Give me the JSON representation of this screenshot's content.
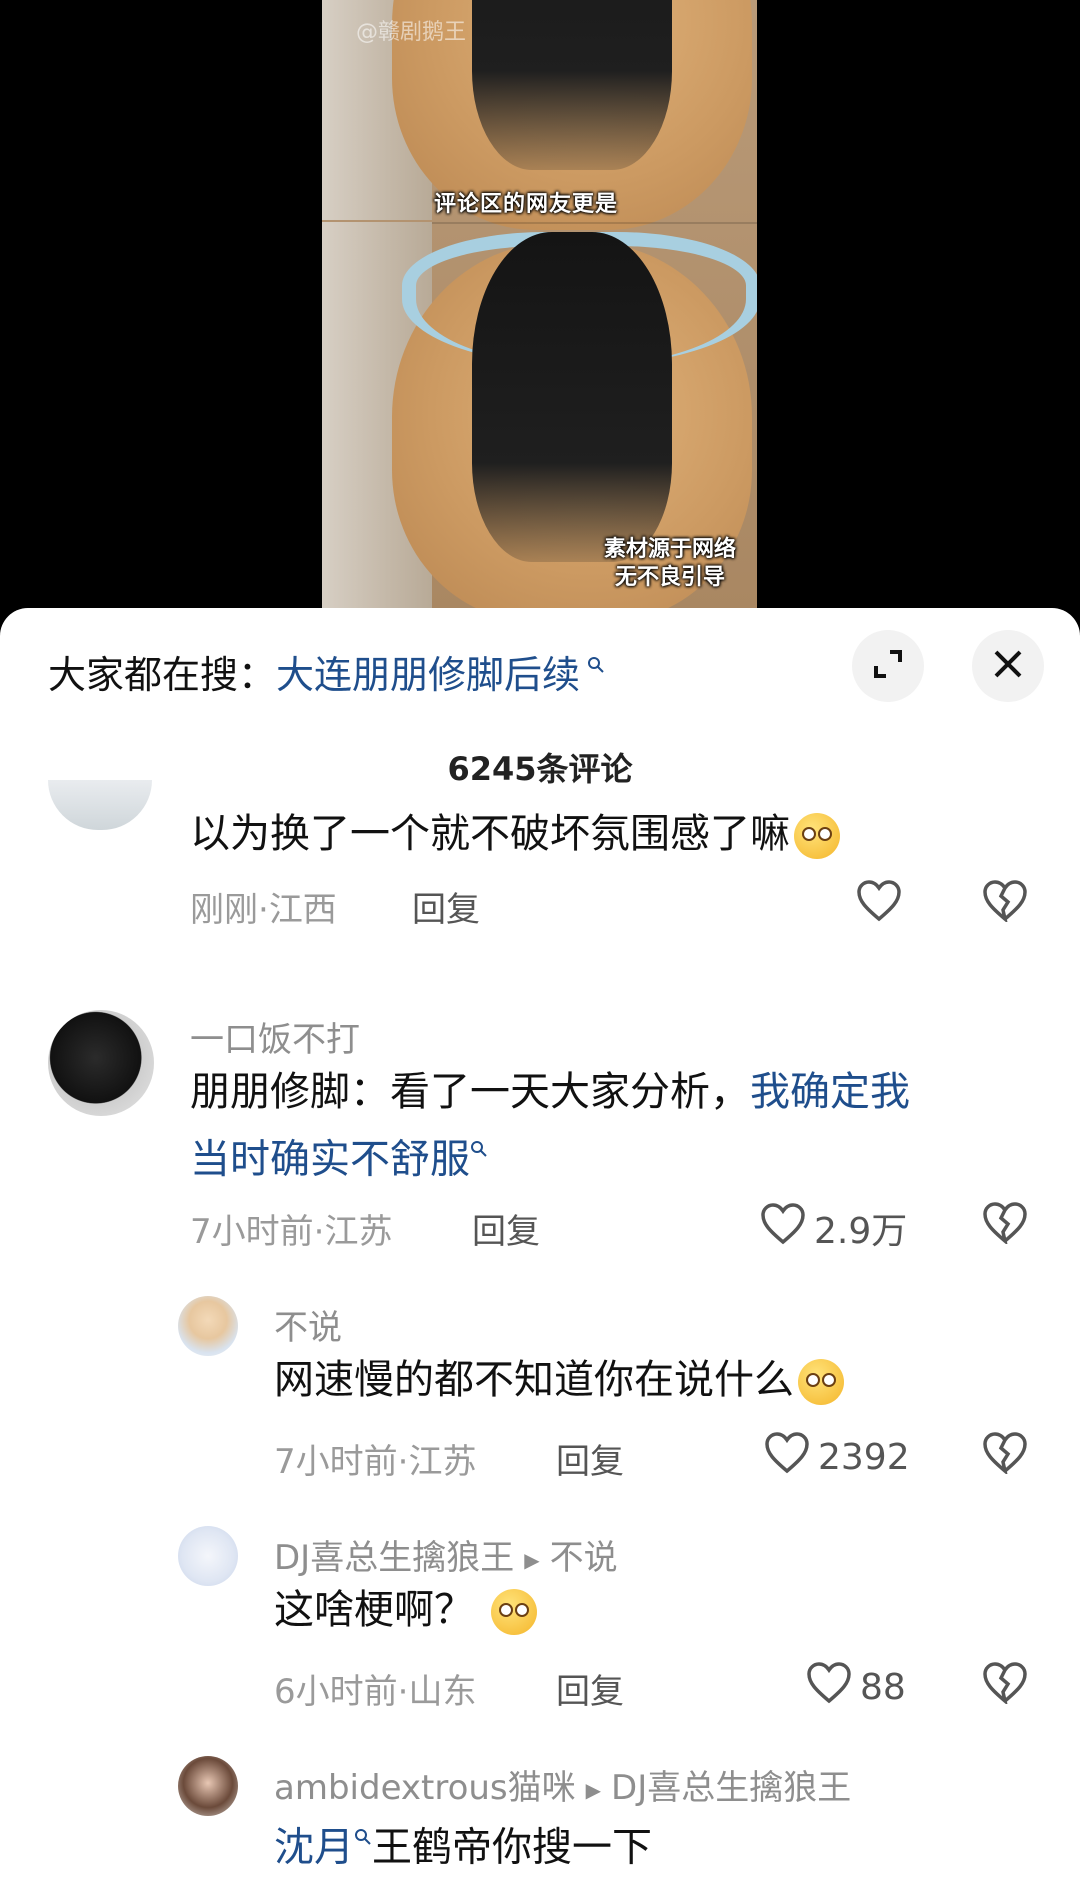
{
  "video": {
    "watermark": "@赣剧鹅王",
    "caption": "评论区的网友更是",
    "disclaimer_line1": "素材源于网络",
    "disclaimer_line2": "无不良引导"
  },
  "search_bar": {
    "prefix": "大家都在搜：",
    "query": "大连朋朋修脚后续",
    "icon": "search-icon"
  },
  "header": {
    "comment_count": "6245条评论",
    "expand_icon": "expand-icon",
    "close_icon": "close-icon"
  },
  "comments": [
    {
      "text": "以为换了一个就不破坏氛围感了嘛",
      "time": "刚刚",
      "location": "江西",
      "reply_label": "回复",
      "likes": ""
    },
    {
      "username": "一口饭不打",
      "text_plain": "朋朋修脚：看了一天大家分析，",
      "text_link_1": "我确定我",
      "text_link_2": "当时确实不舒服",
      "time": "7小时前",
      "location": "江苏",
      "reply_label": "回复",
      "likes": "2.9万"
    },
    {
      "username": "不说",
      "text": "网速慢的都不知道你在说什么",
      "time": "7小时前",
      "location": "江苏",
      "reply_label": "回复",
      "likes": "2392"
    },
    {
      "username": "DJ喜总生擒狼王",
      "reply_to": "不说",
      "text": "这啥梗啊？",
      "time": "6小时前",
      "location": "山东",
      "reply_label": "回复",
      "likes": "88"
    },
    {
      "username": "ambidextrous猫咪",
      "reply_to": "DJ喜总生擒狼王",
      "text_link": "沈月",
      "text_plain": "王鹤帝你搜一下"
    }
  ],
  "colors": {
    "link": "#1f4e8c",
    "meta": "#9a9a9a"
  }
}
